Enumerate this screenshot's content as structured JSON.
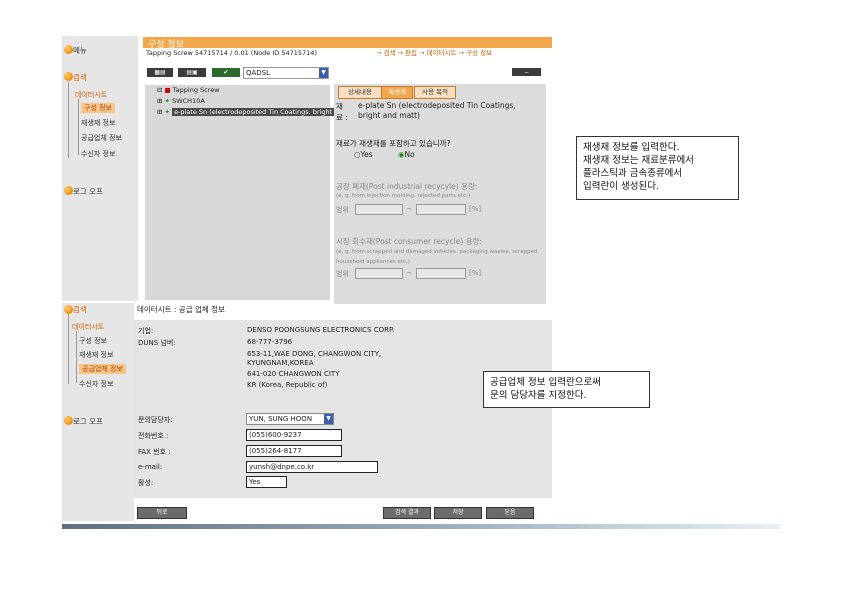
{
  "top_nav": {
    "menu": "메뉴",
    "search": "검색",
    "datasheet": "데이터시트",
    "leaves": [
      "구성 정보",
      "재생재 정보",
      "공급업체 정보",
      "수신자 정보"
    ],
    "logout": "로그 오프"
  },
  "composition": {
    "title": "구성 정보",
    "path": "Tapping Screw 54715714 / 0.01 (Node ID 54715714)",
    "breadcrumb": "→ 검색 → 편집 → 데이터시트 → 구성 정보",
    "toolbar_select": "QADSL",
    "collapse_label": "−",
    "tree": [
      {
        "label": "Tapping Screw"
      },
      {
        "label": "SWCH10A"
      },
      {
        "label": "e-plate Sn (electrodeposited Tin Coatings, bright a"
      }
    ],
    "tabs": [
      "상세내용",
      "재생재",
      "사용 목적"
    ],
    "material_label_1": "재",
    "material_label_2": "료 :",
    "material_value": "e-plate Sn (electrodeposited Tin Coatings, bright and matt)",
    "question": "재료가 재생재를 포함하고 있습니까?",
    "yes": "Yes",
    "no": "No",
    "post_industrial_title": "공장 폐재(Post industrial recycyle) 용량:",
    "post_industrial_example": "(e. g. from injection molding, rejected parts etc.)",
    "range_label": "범위",
    "range_sep": "~",
    "percent": "[%]",
    "post_consumer_title": "시장 회수재(Post consumer recycle) 용량:",
    "post_consumer_example": "(e. g. from scrapped and damaged vehicles, packaging wastes, scrapped household appliances etc.)"
  },
  "callout_top": {
    "lines": [
      "재생재 정보를 입력한다.",
      "재생재 정보는 재료분류에서",
      "플라스틱과 금속종류에서",
      "입력란이 생성된다."
    ]
  },
  "bottom_nav": {
    "search": "검색",
    "datasheet": "데이터시트",
    "leaves": [
      "구성 정보",
      "재생재 정보",
      "공급업체 정보",
      "수신자 정보"
    ],
    "logout": "로그 오프"
  },
  "supplier": {
    "header": "데이터시트 : 공급 업체 정보",
    "company_label": "기업:",
    "company": "DENSO POONGSUNG ELECTRONICS CORP.",
    "duns_label": "DUNS 넘버:",
    "duns": "68-777-3796",
    "address_1": "653-11,WAE DONG, CHANGWON CITY,",
    "address_2": "KYUNGNAM,KOREA",
    "address_3": "641-020 CHANGWON CITY",
    "address_4": "KR (Korea, Republic of)",
    "contact_label": "문의담당자:",
    "contact": "YUN, SUNG HOON",
    "phone_label": "전화번호 :",
    "phone": "(055)600-9237",
    "fax_label": "FAX 번호 :",
    "fax": "(055)264-8177",
    "email_label": "e-mail:",
    "email": "yunsh@dnpe.co.kr",
    "active_label": "활성:",
    "active": "Yes",
    "buttons": {
      "back": "뒤로",
      "search_result": "검색 결과",
      "save": "저장",
      "close": "닫음"
    }
  },
  "callout_bottom": {
    "lines": [
      "공급업체 정보 입력란으로써",
      "문의 담당자를 지정한다."
    ]
  },
  "colors": {
    "accent": "#f4a64a",
    "panel": "#dcdcdc"
  }
}
